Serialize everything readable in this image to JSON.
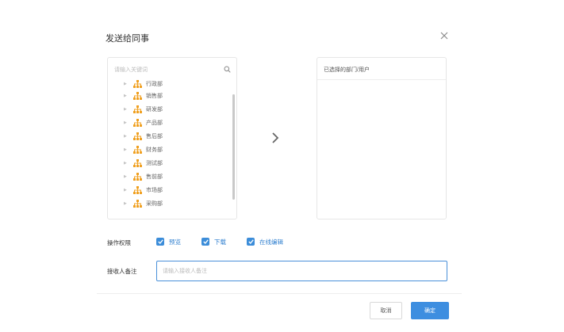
{
  "dialog": {
    "title": "发送给同事",
    "close_icon": "close-icon"
  },
  "left_panel": {
    "search": {
      "placeholder": "请输入关键词",
      "icon": "search-icon"
    },
    "tree": [
      {
        "label": "行政部",
        "icon": "org-icon"
      },
      {
        "label": "销售部",
        "icon": "org-icon"
      },
      {
        "label": "研发部",
        "icon": "org-icon"
      },
      {
        "label": "产品部",
        "icon": "org-icon"
      },
      {
        "label": "售后部",
        "icon": "org-icon"
      },
      {
        "label": "财务部",
        "icon": "org-icon"
      },
      {
        "label": "测试部",
        "icon": "org-icon"
      },
      {
        "label": "售前部",
        "icon": "org-icon"
      },
      {
        "label": "市场部",
        "icon": "org-icon"
      },
      {
        "label": "采购部",
        "icon": "org-icon"
      }
    ]
  },
  "right_panel": {
    "header": "已选择的部门/用户"
  },
  "permissions": {
    "label": "操作权限",
    "options": [
      {
        "label": "预览",
        "checked": true
      },
      {
        "label": "下载",
        "checked": true
      },
      {
        "label": "在线编辑",
        "checked": true
      }
    ]
  },
  "note": {
    "label": "接收人备注",
    "placeholder": "请输入接收人备注",
    "value": ""
  },
  "footer": {
    "cancel_label": "取消",
    "ok_label": "确定"
  },
  "colors": {
    "accent": "#3d8ee0",
    "org_icon": "#f0a020"
  }
}
